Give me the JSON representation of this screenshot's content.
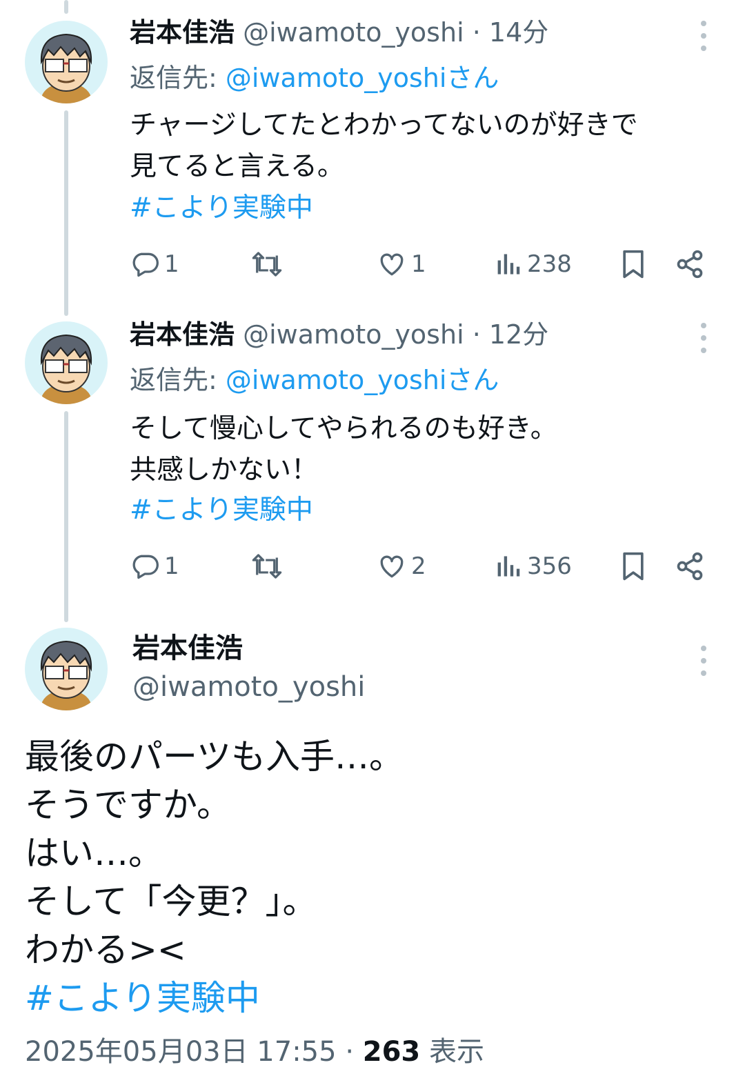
{
  "tweets": [
    {
      "name": "岩本佳浩",
      "handle": "@iwamoto_yoshi",
      "sep": "·",
      "time": "14分",
      "reply_prefix": "返信先: ",
      "reply_mention": "@iwamoto_yoshiさん",
      "text": "チャージしてたとわかってないのが好きで\n見てると言える。",
      "hashtag": "#こより実験中",
      "replies": "1",
      "retweets": "",
      "likes": "1",
      "views": "238"
    },
    {
      "name": "岩本佳浩",
      "handle": "@iwamoto_yoshi",
      "sep": "·",
      "time": "12分",
      "reply_prefix": "返信先: ",
      "reply_mention": "@iwamoto_yoshiさん",
      "text": "そして慢心してやられるのも好き。\n共感しかない！",
      "hashtag": "#こより実験中",
      "replies": "1",
      "retweets": "",
      "likes": "2",
      "views": "356"
    }
  ],
  "main": {
    "name": "岩本佳浩",
    "handle": "@iwamoto_yoshi",
    "text": "最後のパーツも入手…。\nそうですか。\nはい…。\nそして「今更？」。\nわかる><",
    "hashtag": "#こより実験中",
    "datetime": "2025年05月03日 17:55",
    "sep": "·",
    "views_count": "263",
    "views_label": "表示"
  },
  "icons": [
    "reply-icon",
    "retweet-icon",
    "like-icon",
    "views-icon",
    "bookmark-icon",
    "share-icon",
    "more-icon"
  ],
  "colors": {
    "link": "#1d9bf0",
    "secondary": "#536471",
    "text": "#0f1419",
    "thread_line": "#cfd9de"
  }
}
